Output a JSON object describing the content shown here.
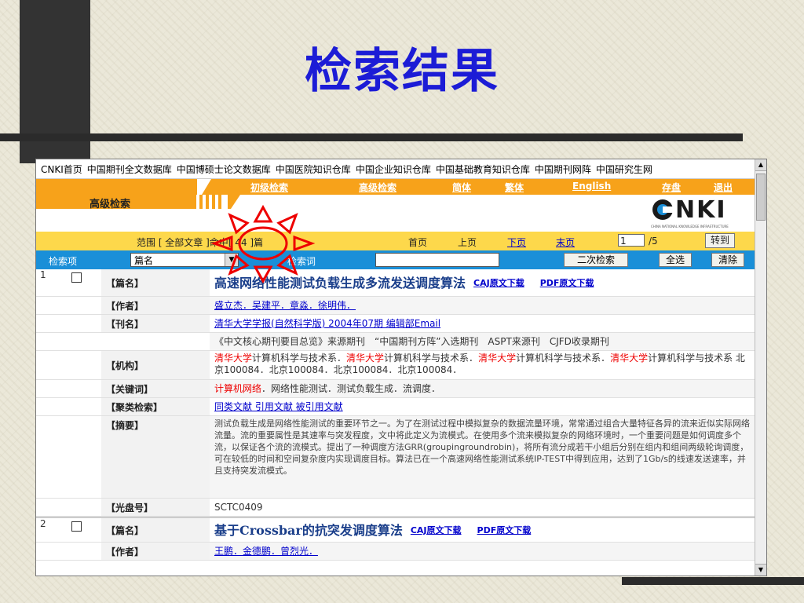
{
  "slide": {
    "title": "检索结果"
  },
  "topnav": [
    "CNKI首页",
    "中国期刊全文数据库",
    "中国博硕士论文数据库",
    "中国医院知识仓库",
    "中国企业知识仓库",
    "中国基础教育知识仓库",
    "中国期刊网阵",
    "中国研究生网"
  ],
  "menu": {
    "basic_search": "初级检索",
    "advanced_search": "高级检索",
    "simplified": "简体",
    "traditional": "繁体",
    "english": "English",
    "save": "存盘",
    "logout": "退出"
  },
  "adv_label": "高级检索",
  "logo": {
    "text": "NKI",
    "sub": "CHINA NATIONAL KNOWLEDGE INFRASTRUCTURE"
  },
  "scope": {
    "text": "范围 [ 全部文章 ]命中[ 44 ]篇",
    "first": "首页",
    "prev": "上页",
    "next": "下页",
    "last": "末页",
    "page": "1",
    "total": "/5",
    "goto": "转到"
  },
  "search": {
    "label": "检索项",
    "field": "篇名",
    "keyword_label": "检索词",
    "secondary": "二次检索",
    "select_all": "全选",
    "clear": "清除"
  },
  "results": [
    {
      "num": "1",
      "title_label": "【篇名】",
      "title": "高速网络性能测试负载生成多流发送调度算法",
      "caj": "CAJ原文下载",
      "pdf": "PDF原文下载",
      "author_label": "【作者】",
      "authors": "盛立杰．吴建平．章淼．徐明伟．",
      "journal_label": "【刊名】",
      "journal": "清华大学学报(自然科学版) 2004年07期 编辑部Email",
      "index": "《中文核心期刊要目总览》来源期刊　“中国期刊方阵”入选期刊　ASPT来源刊　CJFD收录期刊",
      "org_label": "【机构】",
      "org_red": "清华大学",
      "org_rest": "计算机科学与技术系．",
      "org_tail": "计算机科学与技术系 北京100084．北京100084．北京100084．北京100084．",
      "kw_label": "【关键词】",
      "kw_red": "计算机网络",
      "kw_rest": "．网络性能测试．测试负载生成．流调度．",
      "cluster_label": "【聚类检索】",
      "cluster": "同类文献 引用文献 被引用文献",
      "abstract_label": "【摘要】",
      "abstract": "测试负载生成是网络性能测试的重要环节之一。为了在测试过程中模拟复杂的数据流量环境，常常通过组合大量特征各异的流来近似实际网络流量。流的重要属性是其速率与突发程度，文中将此定义为流模式。在使用多个流来模拟复杂的网络环境时，一个重要问题是如何调度多个流，以保证各个流的流模式。提出了一种调度方法GRR(groupingroundrobin)，将所有流分成若干小组后分别在组内和组间两级轮询调度，可在较低的时间和空间复杂度内实现调度目标。算法已在一个高速网络性能测试系统IP-TEST中得到应用，达到了1Gb/s的线速发送速率，并且支持突发流模式。",
      "disc_label": "【光盘号】",
      "disc": "SCTC0409"
    },
    {
      "num": "2",
      "title_label": "【篇名】",
      "title": "基于Crossbar的抗突发调度算法",
      "caj": "CAJ原文下载",
      "pdf": "PDF原文下载",
      "author_label": "【作者】",
      "authors": "王鹏．金德鹏．曾烈光．"
    }
  ]
}
